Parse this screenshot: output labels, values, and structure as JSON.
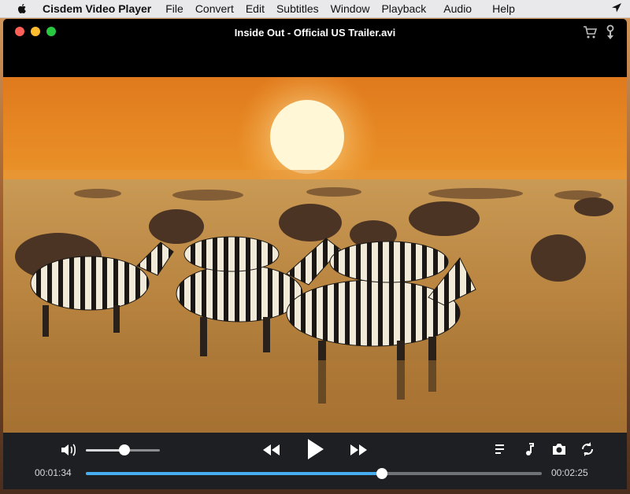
{
  "menubar": {
    "app_name": "Cisdem Video Player",
    "items": [
      "File",
      "Convert",
      "Edit",
      "Subtitles",
      "Window",
      "Playback",
      "Audio",
      "Help"
    ]
  },
  "window": {
    "title": "Inside Out - Official US Trailer.avi"
  },
  "player": {
    "elapsed": "00:01:34",
    "total": "00:02:25",
    "progress": 0.65,
    "volume": 0.52,
    "state": "paused"
  },
  "icons": {
    "apple": "apple-icon",
    "location": "location-arrow-icon",
    "cart": "cart-icon",
    "pin": "pin-icon",
    "volume": "volume-icon",
    "rewind": "rewind-icon",
    "play": "play-icon",
    "fast_forward": "fast-forward-icon",
    "playlist": "playlist-icon",
    "audio_track": "music-note-icon",
    "snapshot": "camera-icon",
    "loop": "loop-icon"
  },
  "colors": {
    "accent": "#46aef0",
    "close": "#fe5f57",
    "minimize": "#febc2e",
    "maximize": "#28c840"
  }
}
